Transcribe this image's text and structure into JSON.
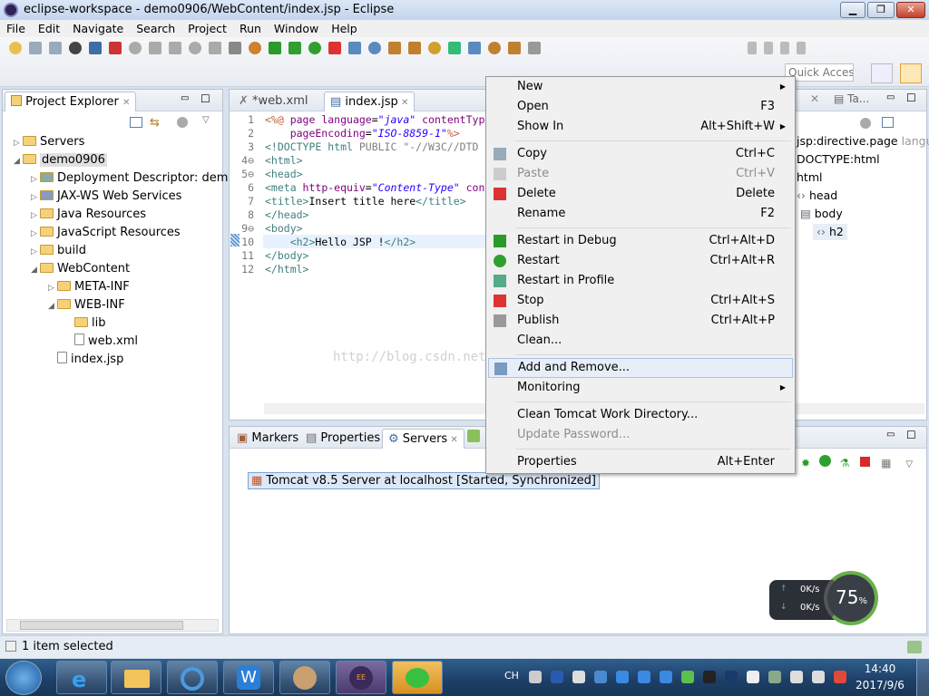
{
  "window": {
    "title": "eclipse-workspace - demo0906/WebContent/index.jsp - Eclipse",
    "minimize": "▁",
    "restore": "❐",
    "close": "✕"
  },
  "menu": [
    "File",
    "Edit",
    "Navigate",
    "Search",
    "Project",
    "Run",
    "Window",
    "Help"
  ],
  "toolbar": {
    "quick_access_placeholder": "Quick Access"
  },
  "project_explorer": {
    "tab": "Project Explorer",
    "tab_close": "✕",
    "items": [
      {
        "label": "Servers",
        "depth": 0,
        "arrow": "▷",
        "icon": "folder"
      },
      {
        "label": "demo0906",
        "depth": 0,
        "arrow": "◢",
        "icon": "project",
        "selected": true
      },
      {
        "label": "Deployment Descriptor: demo0906",
        "depth": 1,
        "arrow": "▷",
        "icon": "descriptor"
      },
      {
        "label": "JAX-WS Web Services",
        "depth": 1,
        "arrow": "▷",
        "icon": "webservice"
      },
      {
        "label": "Java Resources",
        "depth": 1,
        "arrow": "▷",
        "icon": "folder"
      },
      {
        "label": "JavaScript Resources",
        "depth": 1,
        "arrow": "▷",
        "icon": "folder"
      },
      {
        "label": "build",
        "depth": 1,
        "arrow": "▷",
        "icon": "folder"
      },
      {
        "label": "WebContent",
        "depth": 1,
        "arrow": "◢",
        "icon": "folder"
      },
      {
        "label": "META-INF",
        "depth": 2,
        "arrow": "▷",
        "icon": "folder"
      },
      {
        "label": "WEB-INF",
        "depth": 2,
        "arrow": "◢",
        "icon": "folder"
      },
      {
        "label": "lib",
        "depth": 3,
        "arrow": "",
        "icon": "folder"
      },
      {
        "label": "web.xml",
        "depth": 3,
        "arrow": "",
        "icon": "xml-file"
      },
      {
        "label": "index.jsp",
        "depth": 2,
        "arrow": "",
        "icon": "jsp-file"
      }
    ]
  },
  "editor": {
    "tabs": [
      {
        "label": "*web.xml",
        "active": false
      },
      {
        "label": "index.jsp",
        "active": true
      }
    ],
    "line_numbers": [
      "1",
      "2",
      "3",
      "4⊖",
      "5⊖",
      "6",
      "7",
      "8",
      "9⊖",
      "10",
      "11",
      "12"
    ],
    "lines": [
      [
        [
          "dir",
          "<%@ "
        ],
        [
          "attr",
          "page "
        ],
        [
          "attr",
          "language"
        ],
        [
          "",
          "="
        ],
        [
          "val",
          "\"java\""
        ],
        [
          "attr",
          " contentTyp"
        ]
      ],
      [
        [
          "attr",
          "    pageEncoding"
        ],
        [
          "",
          "="
        ],
        [
          "val",
          "\"ISO-8859-1\""
        ],
        [
          "dir",
          "%>"
        ]
      ],
      [
        [
          "tag",
          "<!DOCTYPE html "
        ],
        [
          "gray",
          "PUBLIC \"-//W3C//DTD"
        ]
      ],
      [
        [
          "tag",
          "<html>"
        ]
      ],
      [
        [
          "tag",
          "<head>"
        ]
      ],
      [
        [
          "tag",
          "<meta "
        ],
        [
          "attr",
          "http-equiv"
        ],
        [
          "",
          "="
        ],
        [
          "val",
          "\"Content-Type\""
        ],
        [
          "attr",
          " con"
        ]
      ],
      [
        [
          "tag",
          "<title>"
        ],
        [
          "",
          "Insert title here"
        ],
        [
          "tag",
          "</title>"
        ]
      ],
      [
        [
          "tag",
          "</head>"
        ]
      ],
      [
        [
          "tag",
          "<body>"
        ]
      ],
      [
        [
          "tag",
          "    <h2>"
        ],
        [
          "",
          "Hello JSP !"
        ],
        [
          "tag",
          "</h2>"
        ]
      ],
      [
        [
          "tag",
          "</body>"
        ]
      ],
      [
        [
          "tag",
          "</html>"
        ]
      ]
    ],
    "watermark": "http://blog.csdn.net/HoneyGirls"
  },
  "outline": {
    "tab2": "Ta...",
    "items": [
      {
        "label": "jsp:directive.page",
        "extra": " langua"
      },
      {
        "label": "DOCTYPE:html",
        "extra": ""
      },
      {
        "label": "html",
        "extra": ""
      },
      {
        "label": "head",
        "extra": ""
      },
      {
        "label": "body",
        "extra": ""
      },
      {
        "label": "h2",
        "extra": ""
      }
    ]
  },
  "bottom_panel": {
    "tabs": [
      {
        "label": "Markers"
      },
      {
        "label": "Properties"
      },
      {
        "label": "Servers",
        "active": true
      }
    ],
    "server": "Tomcat v8.5 Server at localhost  [Started, Synchronized]"
  },
  "context_menu": [
    {
      "label": "New",
      "submenu": true
    },
    {
      "label": "Open",
      "shortcut": "F3"
    },
    {
      "label": "Show In",
      "shortcut": "Alt+Shift+W",
      "submenu": true
    },
    {
      "sep": true
    },
    {
      "label": "Copy",
      "shortcut": "Ctrl+C",
      "icon": "copy"
    },
    {
      "label": "Paste",
      "shortcut": "Ctrl+V",
      "icon": "paste",
      "disabled": true
    },
    {
      "label": "Delete",
      "shortcut": "Delete",
      "icon": "delete"
    },
    {
      "label": "Rename",
      "shortcut": "F2"
    },
    {
      "sep": true
    },
    {
      "label": "Restart in Debug",
      "shortcut": "Ctrl+Alt+D",
      "icon": "debug"
    },
    {
      "label": "Restart",
      "shortcut": "Ctrl+Alt+R",
      "icon": "run"
    },
    {
      "label": "Restart in Profile",
      "icon": "profile"
    },
    {
      "label": "Stop",
      "shortcut": "Ctrl+Alt+S",
      "icon": "stop"
    },
    {
      "label": "Publish",
      "shortcut": "Ctrl+Alt+P",
      "icon": "publish"
    },
    {
      "label": "Clean..."
    },
    {
      "sep": true
    },
    {
      "label": "Add and Remove...",
      "icon": "add-remove",
      "highlighted": true
    },
    {
      "label": "Monitoring",
      "submenu": true
    },
    {
      "sep": true
    },
    {
      "label": "Clean Tomcat Work Directory..."
    },
    {
      "label": "Update Password...",
      "disabled": true
    },
    {
      "sep": true
    },
    {
      "label": "Properties",
      "shortcut": "Alt+Enter"
    }
  ],
  "net_widget": {
    "up": "0K/s",
    "down": "0K/s",
    "percent": "75",
    "percent_sign": "%"
  },
  "status": {
    "text": "1 item selected"
  },
  "taskbar": {
    "input_lang": "CH",
    "time": "14:40",
    "date": "2017/9/6"
  },
  "colors": {
    "accent": "#3399ff",
    "menu_bg": "#f0f0f0",
    "highlight": "#e8eef8",
    "taskbar": "#1d3e66"
  }
}
